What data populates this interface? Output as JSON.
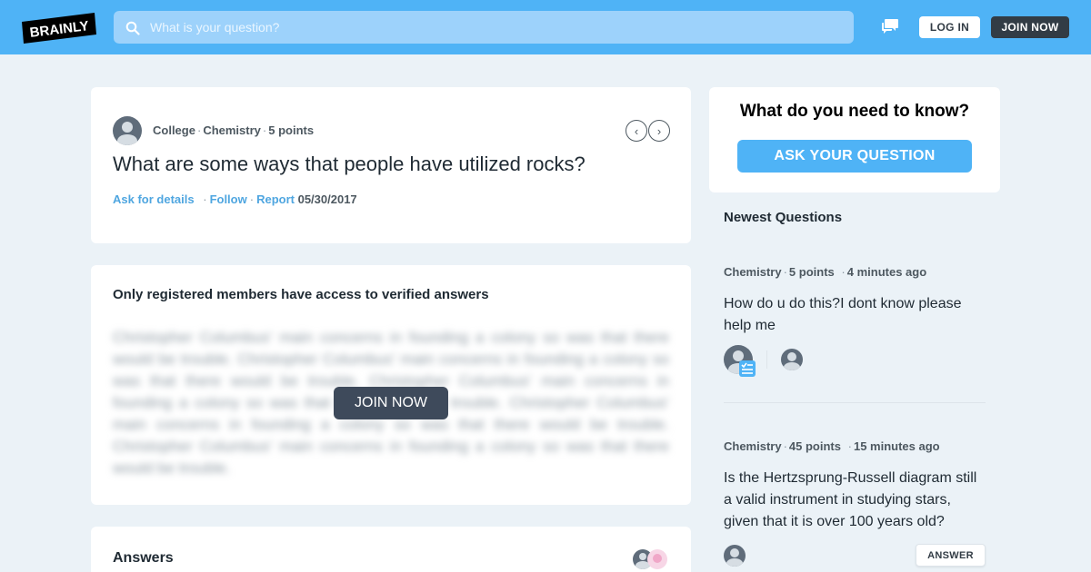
{
  "header": {
    "logo_text": "BRAINLY",
    "search_placeholder": "What is your question?",
    "login_label": "LOG IN",
    "join_label": "JOIN NOW"
  },
  "question": {
    "level": "College",
    "subject": "Chemistry",
    "points": "5 points",
    "title": "What are some ways that people have utilized rocks?",
    "actions": {
      "ask_details": "Ask for details",
      "follow": "Follow",
      "report": "Report"
    },
    "date": "05/30/2017"
  },
  "locked": {
    "title": "Only registered members have access to verified answers",
    "blurred_text": "Christopher Columbus' main concerns in founding a colony so was that there would be trouble. Christopher Columbus' main concerns in founding a colony so was that there would be trouble. Christopher Columbus' main concerns in founding a colony so was that there would be trouble. Christopher Columbus' main concerns in founding a colony so was that there would be trouble. Christopher Columbus' main concerns in founding a colony so was that there would be trouble.",
    "join_label": "JOIN NOW"
  },
  "answers": {
    "title": "Answers"
  },
  "sidebar": {
    "ask_title": "What do you need to know?",
    "ask_button": "ASK YOUR QUESTION",
    "newest_title": "Newest Questions",
    "questions": [
      {
        "subject": "Chemistry",
        "points": "5 points",
        "time": "4 minutes ago",
        "text": "How do u do this?I dont know please help me"
      },
      {
        "subject": "Chemistry",
        "points": "45 points",
        "time": "15 minutes ago",
        "text": "Is the Hertzsprung-Russell diagram still a valid instrument in studying stars, given that it is over 100 years old?"
      }
    ],
    "answer_button": "ANSWER"
  },
  "icons": {
    "search": "search-icon",
    "messages": "messages-icon",
    "prev": "chevron-left-icon",
    "next": "chevron-right-icon"
  },
  "colors": {
    "brand_blue": "#4fb3f6",
    "dark": "#323c45",
    "link": "#4fa6e0",
    "background": "#ebf2f7"
  }
}
